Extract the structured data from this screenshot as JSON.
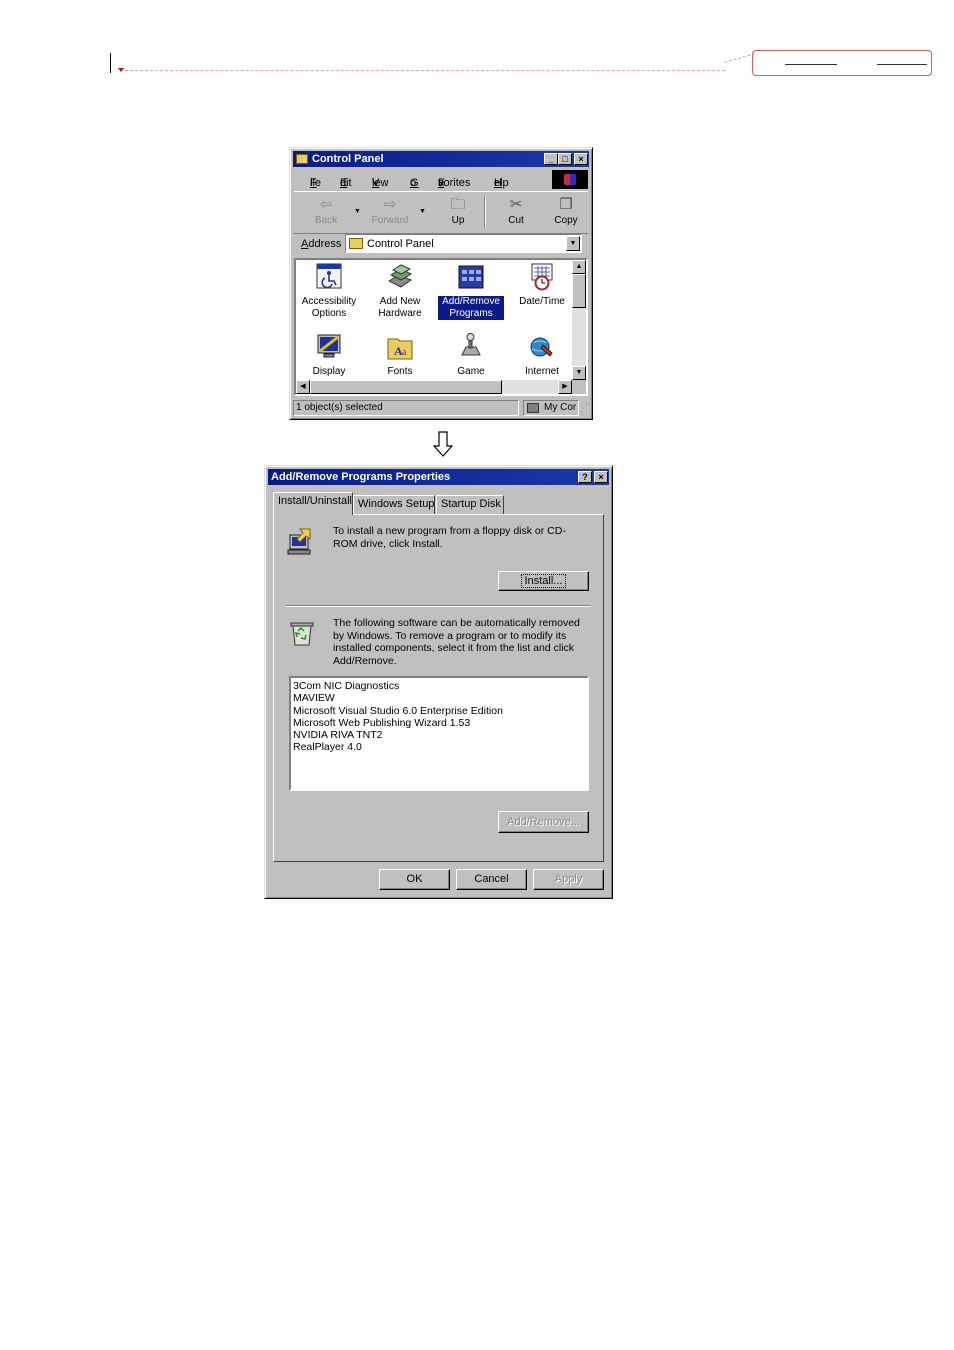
{
  "control_panel": {
    "title": "Control Panel",
    "menu": [
      "File",
      "Edit",
      "View",
      "Go",
      "Favorites",
      "Help"
    ],
    "toolbar": {
      "back": "Back",
      "forward": "Forward",
      "up": "Up",
      "cut": "Cut",
      "copy": "Copy"
    },
    "address_label": "Address",
    "address_value": "Control Panel",
    "items": [
      {
        "label": "Accessibility Options",
        "selected": false,
        "icon": "accessibility-icon"
      },
      {
        "label": "Add New Hardware",
        "selected": false,
        "icon": "hardware-icon"
      },
      {
        "label": "Add/Remove Programs",
        "selected": true,
        "icon": "add-remove-programs-icon"
      },
      {
        "label": "Date/Time",
        "selected": false,
        "icon": "datetime-icon"
      },
      {
        "label": "Display",
        "selected": false,
        "icon": "display-icon"
      },
      {
        "label": "Fonts",
        "selected": false,
        "icon": "fonts-icon"
      },
      {
        "label": "Game",
        "selected": false,
        "icon": "game-controllers-icon"
      },
      {
        "label": "Internet",
        "selected": false,
        "icon": "internet-icon"
      }
    ],
    "status": {
      "left": "1 object(s) selected",
      "right": "My Cor"
    }
  },
  "dialog": {
    "title": "Add/Remove Programs Properties",
    "tabs": [
      "Install/Uninstall",
      "Windows Setup",
      "Startup Disk"
    ],
    "install_text": "To install a new program from a floppy disk or CD-ROM drive, click Install.",
    "install_button": "Install...",
    "remove_text": "The following software can be automatically removed by Windows. To remove a program or to modify its installed components, select it from the list and click Add/Remove.",
    "programs": [
      "3Com NIC Diagnostics",
      "MAVIEW",
      "Microsoft Visual Studio 6.0 Enterprise Edition",
      "Microsoft Web Publishing Wizard 1.53",
      "NVIDIA RIVA TNT2",
      "RealPlayer 4.0"
    ],
    "add_remove_button": "Add/Remove...",
    "ok_button": "OK",
    "cancel_button": "Cancel",
    "apply_button": "Apply"
  },
  "colors": {
    "titlebar": "#0a1a8a",
    "face": "#c0c0c0",
    "selection": "#0a1a8a",
    "annotation": "#e05a5a"
  }
}
